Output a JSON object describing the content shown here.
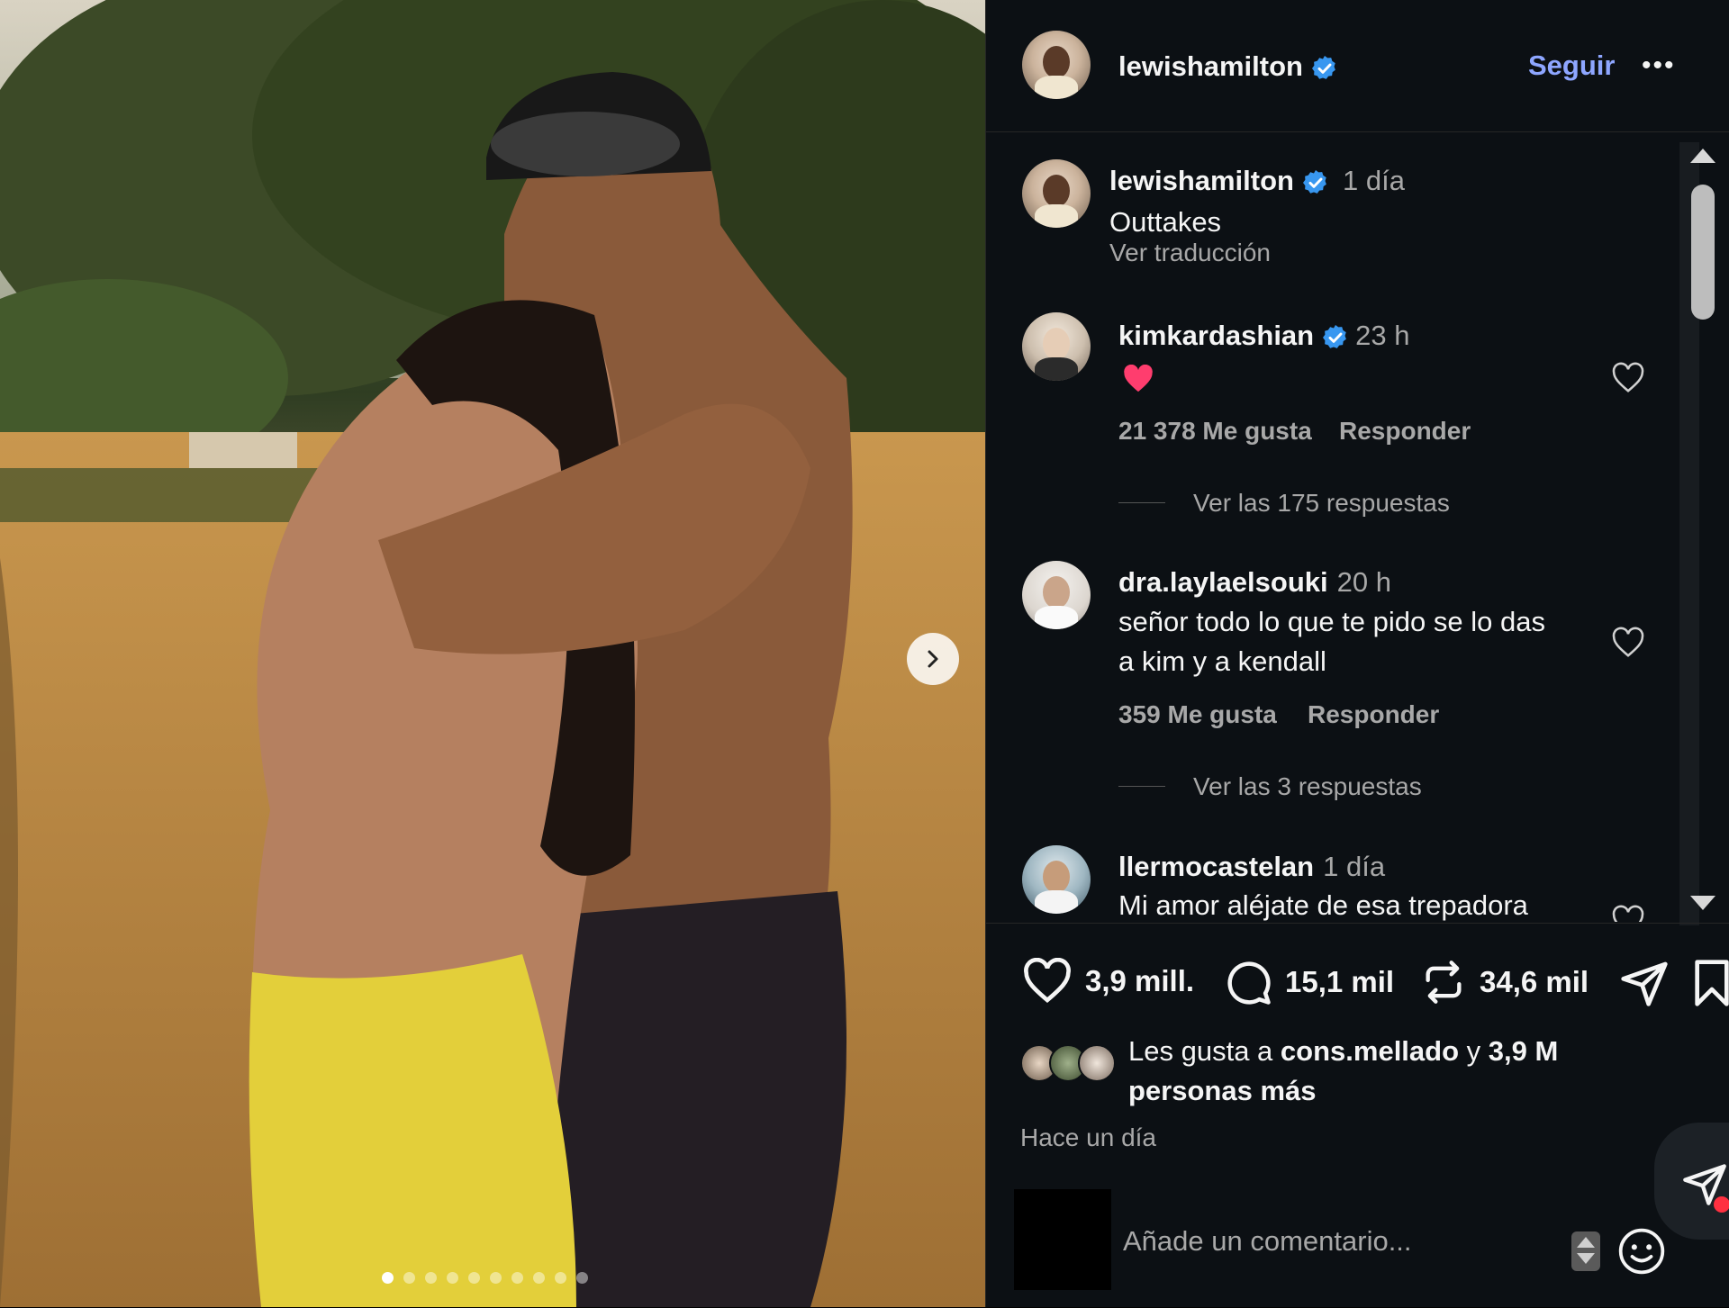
{
  "post": {
    "author": "lewishamilton",
    "follow_label": "Seguir",
    "more_label": "•••",
    "caption": {
      "username": "lewishamilton",
      "time": "1 día",
      "text": "Outtakes",
      "translate": "Ver traducción"
    },
    "carousel": {
      "total": 10,
      "active": 0
    }
  },
  "comments": [
    {
      "username": "kimkardashian",
      "verified": true,
      "time": "23 h",
      "text": "❤️",
      "likes": "21 378 Me gusta",
      "reply": "Responder",
      "view_replies": "Ver las 175 respuestas"
    },
    {
      "username": "dra.laylaelsouki",
      "verified": false,
      "time": "20 h",
      "text_line1": "señor todo lo que te pido se lo das",
      "text_line2": "a kim y a kendall",
      "likes": "359 Me gusta",
      "reply": "Responder",
      "view_replies": "Ver las 3 respuestas"
    },
    {
      "username": "llermocastelan",
      "verified": false,
      "time": "1 día",
      "text": "Mi amor aléjate de esa trepadora"
    }
  ],
  "actions": {
    "likes": "3,9 mill.",
    "comments": "15,1 mil",
    "reposts": "34,6 mil"
  },
  "liked_by": {
    "prefix": "Les gusta a",
    "user": "cons.mellado",
    "mid": "y",
    "count": "3,9 M",
    "suffix": "personas más"
  },
  "posted_ago": "Hace un día",
  "comment_input": {
    "placeholder": "Añade un comentario..."
  },
  "colors": {
    "background": "#0c1014",
    "follow": "#8ea6ff",
    "verified": "#3897f0",
    "heart": "#ff3040"
  }
}
